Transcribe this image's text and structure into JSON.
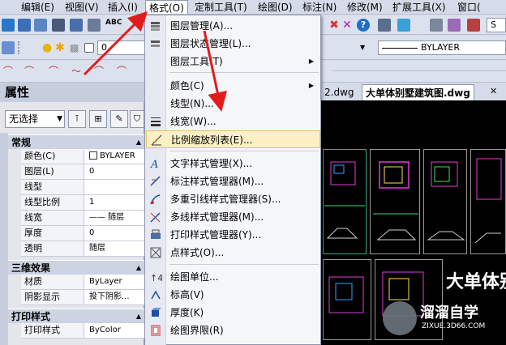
{
  "menubar": {
    "items": [
      "编辑(E)",
      "视图(V)",
      "插入(I)",
      "格式(O)",
      "定制工具(T)",
      "绘图(D)",
      "标注(N)",
      "修改(M)",
      "扩展工具(X)",
      "窗口("
    ],
    "active_index": 3
  },
  "toolbar": {
    "abc_label": "ABC",
    "layer_combo_value": "0",
    "linetype_combo_value": "BYLAYER",
    "right_combo_value": "S"
  },
  "properties": {
    "title": "属性",
    "selection": "无选择",
    "sections": [
      {
        "title": "常规",
        "rows": [
          {
            "key": "颜色(C)",
            "value": "BYLAYER",
            "swatch": "#ffffff"
          },
          {
            "key": "图层(L)",
            "value": "0"
          },
          {
            "key": "线型",
            "value": ""
          },
          {
            "key": "线型比例",
            "value": "1"
          },
          {
            "key": "线宽",
            "value": "—— 随层"
          },
          {
            "key": "厚度",
            "value": "0"
          },
          {
            "key": "透明",
            "value": "随层"
          }
        ]
      },
      {
        "title": "三维效果",
        "rows": [
          {
            "key": "材质",
            "value": "ByLayer"
          },
          {
            "key": "阴影显示",
            "value": "投下阴影..."
          }
        ]
      },
      {
        "title": "打印样式",
        "rows": [
          {
            "key": "打印样式",
            "value": "ByColor"
          }
        ]
      }
    ]
  },
  "drawing": {
    "tabs": [
      "2.dwg",
      "大单体别墅建筑图.dwg"
    ],
    "big_title": "大单体别",
    "watermark_title": "溜溜自学",
    "watermark_url": "ZIXUE.3D66.COM"
  },
  "format_menu": {
    "items": [
      {
        "label": "图层管理(A)...",
        "icon": "layer-manager-icon"
      },
      {
        "label": "图层状态管理(L)...",
        "icon": "layer-state-icon"
      },
      {
        "label": "图层工具(T)",
        "icon": "",
        "submenu": true
      },
      {
        "sep": true
      },
      {
        "label": "颜色(C)",
        "icon": "",
        "submenu": true
      },
      {
        "label": "线型(N)...",
        "icon": ""
      },
      {
        "label": "线宽(W)...",
        "icon": "lineweight-icon"
      },
      {
        "label": "比例缩放列表(E)...",
        "icon": "scale-list-icon",
        "highlighted": true
      },
      {
        "sep": true
      },
      {
        "label": "文字样式管理(X)...",
        "icon": "text-style-icon"
      },
      {
        "label": "标注样式管理器(M)...",
        "icon": "dimension-style-icon"
      },
      {
        "label": "多重引线样式管理器(S)...",
        "icon": "multileader-style-icon"
      },
      {
        "label": "多线样式管理器(M)...",
        "icon": "multiline-style-icon"
      },
      {
        "label": "打印样式管理器(Y)...",
        "icon": "plot-style-icon"
      },
      {
        "label": "点样式(O)...",
        "icon": "point-style-icon"
      },
      {
        "sep": true
      },
      {
        "label": "绘图单位...",
        "icon": "units-icon"
      },
      {
        "label": "标高(V)",
        "icon": "elevation-icon"
      },
      {
        "label": "厚度(K)",
        "icon": "thickness-icon"
      },
      {
        "label": "绘图界限(R)",
        "icon": "limits-icon"
      }
    ]
  },
  "colors": {
    "menubar_bg": "#d6dbe9",
    "highlight_bg": "#fdf1c4",
    "annotation_arrow": "#e21b1b",
    "canvas_bg": "#000000"
  }
}
